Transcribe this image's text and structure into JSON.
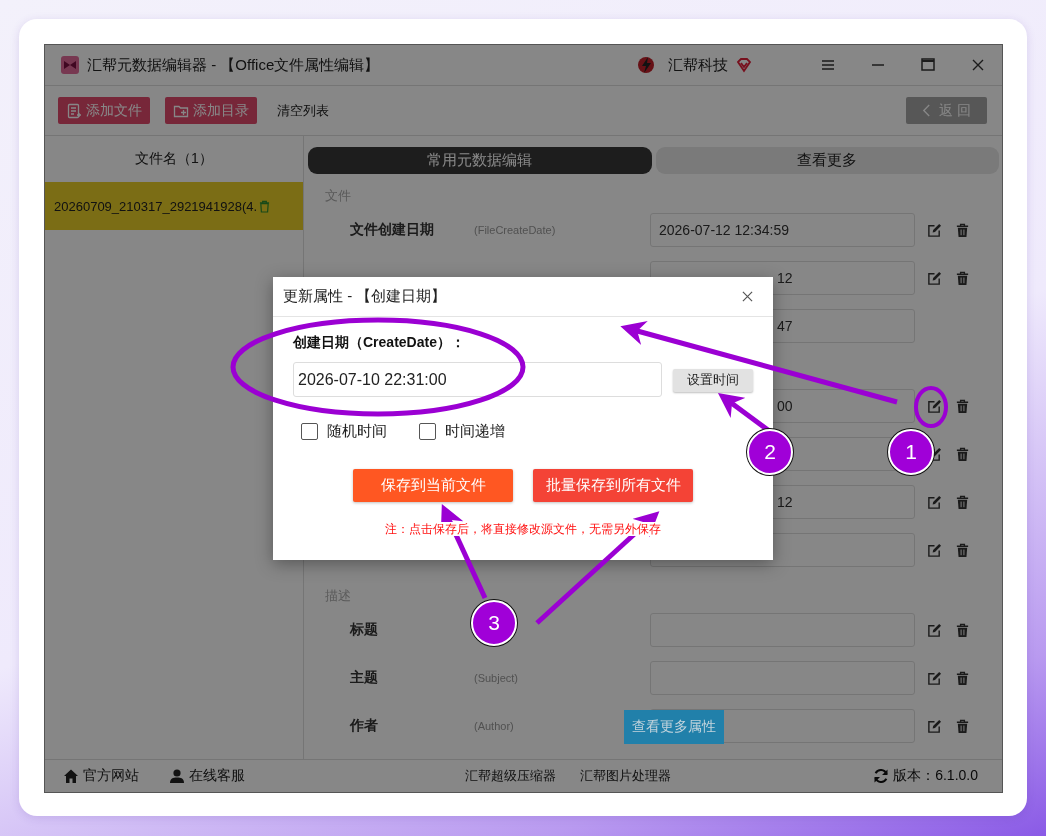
{
  "window": {
    "title": "汇帮元数据编辑器 - 【Office文件属性编辑】",
    "brand": "汇帮科技"
  },
  "toolbar": {
    "buttons": [
      {
        "label": "添加文件",
        "kind": "add-file"
      },
      {
        "label": "添加目录",
        "kind": "add-folder"
      },
      {
        "label": "清空列表",
        "kind": "plain"
      }
    ],
    "back": "返 回"
  },
  "file_list": {
    "header": "文件名（1）",
    "items": [
      {
        "name": "20260709_210317_2921941928(4.",
        "selected": true
      }
    ]
  },
  "tabs": [
    {
      "label": "常用元数据编辑",
      "selected": true
    },
    {
      "label": "查看更多",
      "selected": false
    }
  ],
  "sections": [
    {
      "title": "文件",
      "rows": [
        {
          "label": "文件创建日期",
          "hint": "(FileCreateDate)",
          "value": "2026-07-12 12:34:59",
          "kind": "full",
          "actions": true
        },
        {
          "value": "12",
          "kind": "partial",
          "actions": true
        },
        {
          "value": "47",
          "kind": "partial",
          "actions": false
        }
      ]
    },
    {
      "rows": [
        {
          "value": "00",
          "kind": "partial",
          "actions": true
        },
        {
          "kind": "partial",
          "actions": true
        },
        {
          "value": "12",
          "kind": "partial",
          "actions": true
        },
        {
          "kind": "partial",
          "actions": true
        }
      ]
    },
    {
      "title": "描述",
      "rows": [
        {
          "label": "标题",
          "kind": "full",
          "actions": true
        },
        {
          "label": "主题",
          "hint": "(Subject)",
          "kind": "full",
          "actions": true
        },
        {
          "label": "作者",
          "hint": "(Author)",
          "kind": "full",
          "actions": true
        }
      ]
    }
  ],
  "more_button": "查看更多属性",
  "status_bar": {
    "links": [
      {
        "label": "官方网站",
        "kind": "home"
      },
      {
        "label": "在线客服",
        "kind": "support"
      },
      {
        "label": "汇帮超级压缩器",
        "kind": "plain"
      },
      {
        "label": "汇帮图片处理器",
        "kind": "plain"
      }
    ],
    "version": "版本：6.1.0.0"
  },
  "dialog": {
    "title": "更新属性 - 【创建日期】",
    "field_label": "创建日期（CreateDate）：",
    "value": "2026-07-10 22:31:00",
    "set_time": "设置时间",
    "options": [
      {
        "label": "随机时间",
        "checked": false
      },
      {
        "label": "时间递增",
        "checked": false
      }
    ],
    "actions": [
      {
        "label": "保存到当前文件",
        "kind": "current"
      },
      {
        "label": "批量保存到所有文件",
        "kind": "batch"
      }
    ],
    "note": "注：点击保存后，将直接修改源文件，无需另外保存"
  },
  "annotations": {
    "badges": [
      {
        "label": "1"
      },
      {
        "label": "2"
      },
      {
        "label": "3"
      }
    ]
  }
}
